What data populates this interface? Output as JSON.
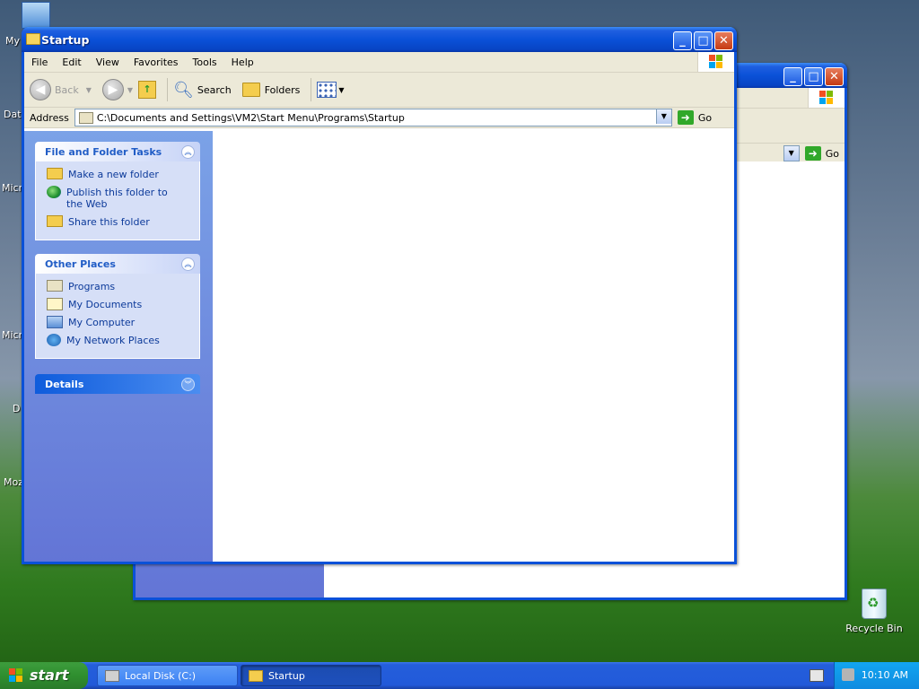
{
  "desktop": {
    "icons_left": [
      "My",
      "Dat",
      "Micr",
      "Micr",
      "D",
      "Moz"
    ],
    "recycle_bin": "Recycle Bin"
  },
  "back_window": {
    "go_label": "Go"
  },
  "window": {
    "title": "Startup",
    "controls": {
      "minimize": "_",
      "maximize": "□",
      "close": "✕"
    },
    "menu": [
      "File",
      "Edit",
      "View",
      "Favorites",
      "Tools",
      "Help"
    ],
    "toolbar": {
      "back": "Back",
      "forward": "",
      "search": "Search",
      "folders": "Folders"
    },
    "address": {
      "label": "Address",
      "value": "C:\\Documents and Settings\\VM2\\Start Menu\\Programs\\Startup",
      "go": "Go"
    },
    "panels": {
      "file_tasks": {
        "title": "File and Folder Tasks",
        "items": [
          "Make a new folder",
          "Publish this folder to the Web",
          "Share this folder"
        ]
      },
      "other_places": {
        "title": "Other Places",
        "items": [
          "Programs",
          "My Documents",
          "My Computer",
          "My Network Places"
        ]
      },
      "details": {
        "title": "Details"
      }
    }
  },
  "taskbar": {
    "start": "start",
    "tasks": [
      {
        "label": "Local Disk (C:)",
        "active": false
      },
      {
        "label": "Startup",
        "active": true
      }
    ],
    "clock": "10:10 AM"
  },
  "colors": {
    "title_blue": "#0a51d8",
    "start_green": "#2f8f2f",
    "taskbar_blue": "#245edb",
    "tray_blue": "#0f8be0"
  }
}
